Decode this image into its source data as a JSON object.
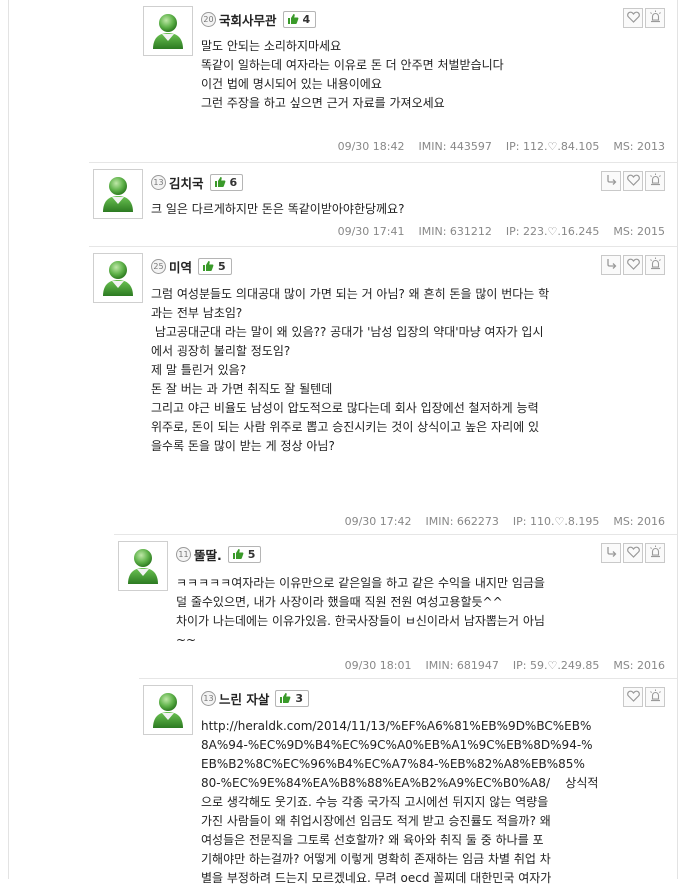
{
  "comments": [
    {
      "level": "20",
      "nick": "국회사무관",
      "likes": "4",
      "lines": [
        "말도 안되는 소리하지마세요",
        "똑같이 일하는데 여자라는 이유로 돈 더 안주면 처벌받습니다",
        "이건 법에 명시되어 있는 내용이에요",
        "",
        "그런 주장을 하고 싶으면 근거 자료를 가져오세요"
      ],
      "date": "09/30 18:42",
      "imin": "IMIN: 443597",
      "ip": "IP: 112.♡.84.105",
      "ms": "MS: 2013"
    },
    {
      "level": "13",
      "nick": "김치국",
      "likes": "6",
      "lines": [
        "크 일은 다르게하지만 돈은 똑같이받아야한당께요?"
      ],
      "date": "09/30 17:41",
      "imin": "IMIN: 631212",
      "ip": "IP: 223.♡.16.245",
      "ms": "MS: 2015"
    },
    {
      "level": "25",
      "nick": "미역",
      "likes": "5",
      "lines": [
        "그럼 여성분들도 의대공대 많이 가면 되는 거 아님? 왜 흔히 돈을 많이 번다는 학",
        "과는 전부 남초임?",
        "",
        " 남고공대군대 라는 말이 왜 있음?? 공대가 '남성 입장의 약대'마냥 여자가 입시",
        "에서 굉장히 불리할 정도임?",
        "",
        "제 말 틀린거 있음?",
        "돈 잘 버는 과 가면 취직도 잘 될텐데",
        "",
        "그리고 야근 비율도 남성이 압도적으로 많다는데 회사 입장에선 철저하게 능력",
        "위주로, 돈이 되는 사람 위주로 뽑고 승진시키는 것이 상식이고 높은 자리에 있",
        "을수록 돈을 많이 받는 게 정상 아님?"
      ],
      "date": "09/30 17:42",
      "imin": "IMIN: 662273",
      "ip": "IP: 110.♡.8.195",
      "ms": "MS: 2016"
    },
    {
      "level": "11",
      "nick": "뚤딸.",
      "likes": "5",
      "lines": [
        "ㅋㅋㅋㅋㅋ여자라는 이유만으로 같은일을 하고 같은 수익을 내지만 임금을",
        "덜 줄수있으면, 내가 사장이라 했을때 직원 전원 여성고용할듯^^",
        "차이가 나는데에는 이유가있음. 한국사장들이 ㅂ신이라서 남자뽑는거 아님",
        "~~"
      ],
      "date": "09/30 18:01",
      "imin": "IMIN: 681947",
      "ip": "IP: 59.♡.249.85",
      "ms": "MS: 2016"
    },
    {
      "level": "13",
      "nick": "느린 자살",
      "likes": "3",
      "lines": [
        "http://heraldk.com/2014/11/13/%EF%A6%81%EB%9D%BC%EB%",
        "8A%94-%EC%9D%B4%EC%9C%A0%EB%A1%9C%EB%8D%94-%",
        "EB%B2%8C%EC%96%B4%EC%A7%84-%EB%82%A8%EB%85%",
        "80-%EC%9E%84%EA%B8%88%EA%B2%A9%EC%B0%A8/    상식적",
        "으로 생각해도 웃기죠. 수능 각종 국가직 고시에선 뒤지지 않는 역량을",
        "가진 사람들이 왜 취업시장에선 임금도 적게 받고 승진률도 적을까? 왜",
        "여성들은 전문직을 그토록 선호할까? 왜 육아와 취직 둘 중 하나를 포",
        "기해야만 하는걸까? 어떻게 이렇게 명확히 존재하는 임금 차별 취업 차",
        "별을 부정하려 드는지 모르겠네요. 무려 oecd 꼴찌데 대한민국 여자가"
      ],
      "date": "",
      "imin": "",
      "ip": "",
      "ms": ""
    }
  ],
  "icons": {
    "reply": "reply-arrow-icon",
    "like": "heart-icon",
    "report": "siren-icon",
    "thumb": "thumbs-up-icon"
  },
  "colors": {
    "thumb_green": "#3a9a2a",
    "border": "#e6e6e6",
    "meta": "#888888"
  }
}
